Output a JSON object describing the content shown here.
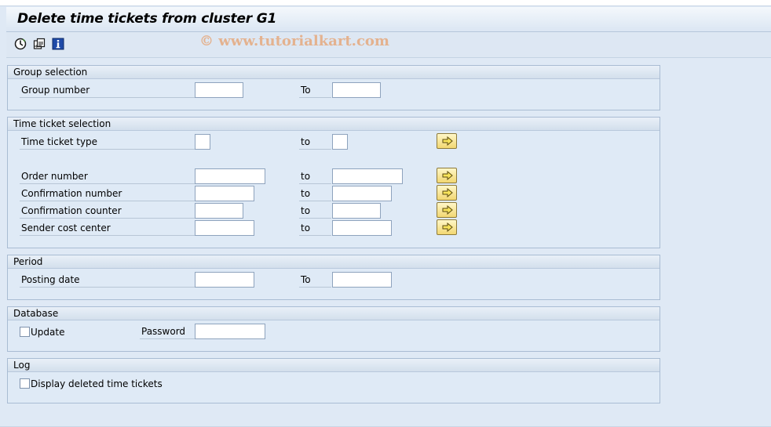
{
  "title": "Delete time tickets from cluster G1",
  "watermark": "© www.tutorialkart.com",
  "toolbar": {
    "icons": [
      "execute-icon",
      "get-variant-icon",
      "info-icon"
    ]
  },
  "groups": {
    "group_selection": {
      "header": "Group selection",
      "group_number_label": "Group number",
      "to_label": "To"
    },
    "time_ticket_selection": {
      "header": "Time ticket selection",
      "time_ticket_type_label": "Time ticket type",
      "order_number_label": "Order number",
      "confirmation_number_label": "Confirmation number",
      "confirmation_counter_label": "Confirmation counter",
      "sender_cost_center_label": "Sender cost center",
      "to_label": "to"
    },
    "period": {
      "header": "Period",
      "posting_date_label": "Posting date",
      "to_label": "To"
    },
    "database": {
      "header": "Database",
      "update_label": "Update",
      "update_checked": false,
      "password_label": "Password"
    },
    "log": {
      "header": "Log",
      "display_deleted_label": "Display deleted time tickets",
      "display_deleted_checked": false
    }
  },
  "colors": {
    "background": "#dfe9f5",
    "multi_button": "#f2d772"
  }
}
